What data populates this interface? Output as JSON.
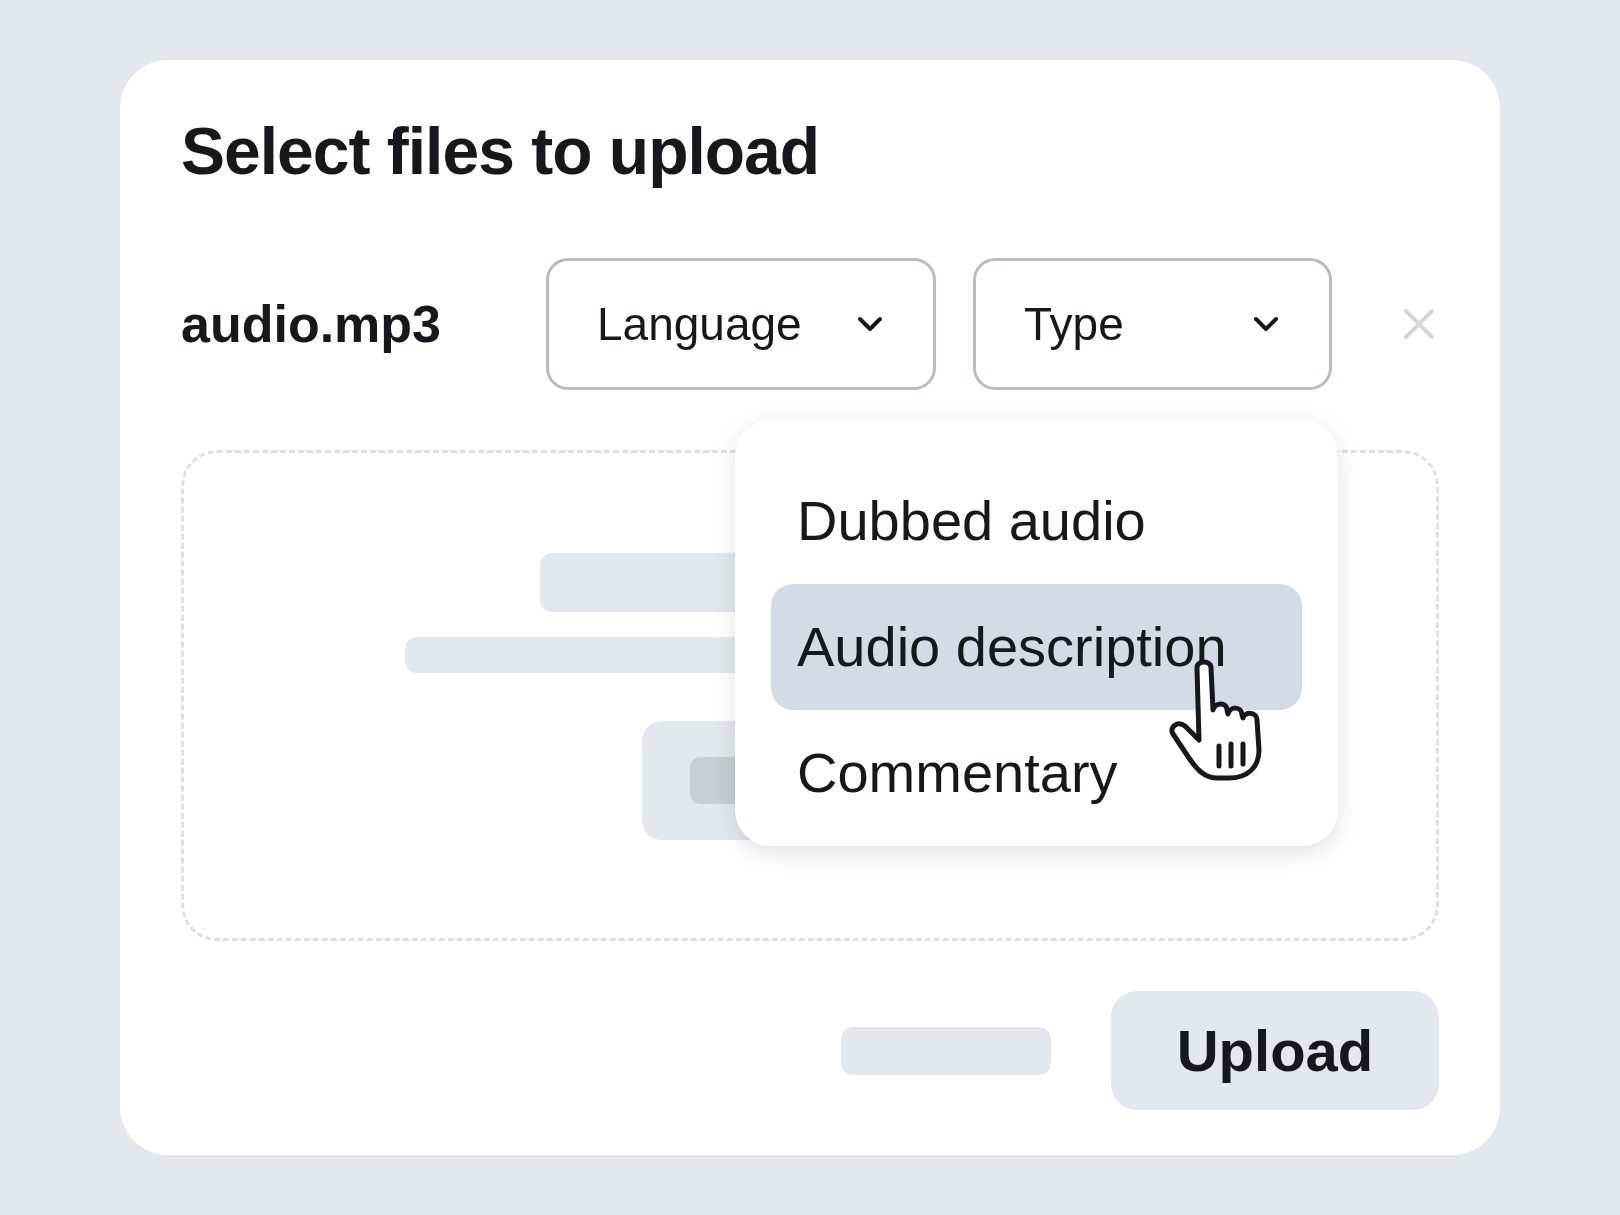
{
  "title": "Select files to upload",
  "file": {
    "name": "audio.mp3"
  },
  "dropdowns": [
    {
      "label": "Language"
    },
    {
      "label": "Type"
    }
  ],
  "menu": [
    {
      "label": "Dubbed audio",
      "selected": false
    },
    {
      "label": "Audio description",
      "selected": true
    },
    {
      "label": "Commentary",
      "selected": false
    }
  ],
  "upload_button": "Upload"
}
